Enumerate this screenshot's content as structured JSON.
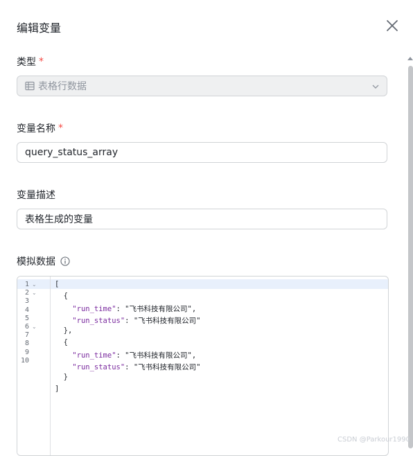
{
  "dialog": {
    "title": "编辑变量",
    "close_icon": "close-icon"
  },
  "type_field": {
    "label": "类型",
    "required_mark": "*",
    "value": "表格行数据",
    "icon": "table-icon",
    "disabled": true
  },
  "name_field": {
    "label": "变量名称",
    "required_mark": "*",
    "value": "query_status_array"
  },
  "desc_field": {
    "label": "变量描述",
    "value": "表格生成的变量"
  },
  "mock_field": {
    "label": "模拟数据",
    "info_icon": "info-icon"
  },
  "editor": {
    "line_numbers": [
      "1",
      "2",
      "3",
      "4",
      "5",
      "6",
      "7",
      "8",
      "9",
      "10"
    ],
    "lines": [
      {
        "text": "["
      },
      {
        "text": "  {"
      },
      {
        "key": "\"run_time\"",
        "value": "\"飞书科技有限公司\"",
        "trail": ","
      },
      {
        "key": "\"run_status\"",
        "value": "\"飞书科技有限公司\"",
        "trail": ""
      },
      {
        "text": "  },"
      },
      {
        "text": "  {"
      },
      {
        "key": "\"run_time\"",
        "value": "\"飞书科技有限公司\"",
        "trail": ","
      },
      {
        "key": "\"run_status\"",
        "value": "\"飞书科技有限公司\"",
        "trail": ""
      },
      {
        "text": "  }"
      },
      {
        "text": "]"
      }
    ]
  },
  "watermark": "CSDN @Parkour1990",
  "colors": {
    "required": "#f54a45",
    "border": "#d0d3d6",
    "disabled_bg": "#eff0f1",
    "json_key": "#7a2a9e",
    "active_line": "#e8f0fc"
  }
}
